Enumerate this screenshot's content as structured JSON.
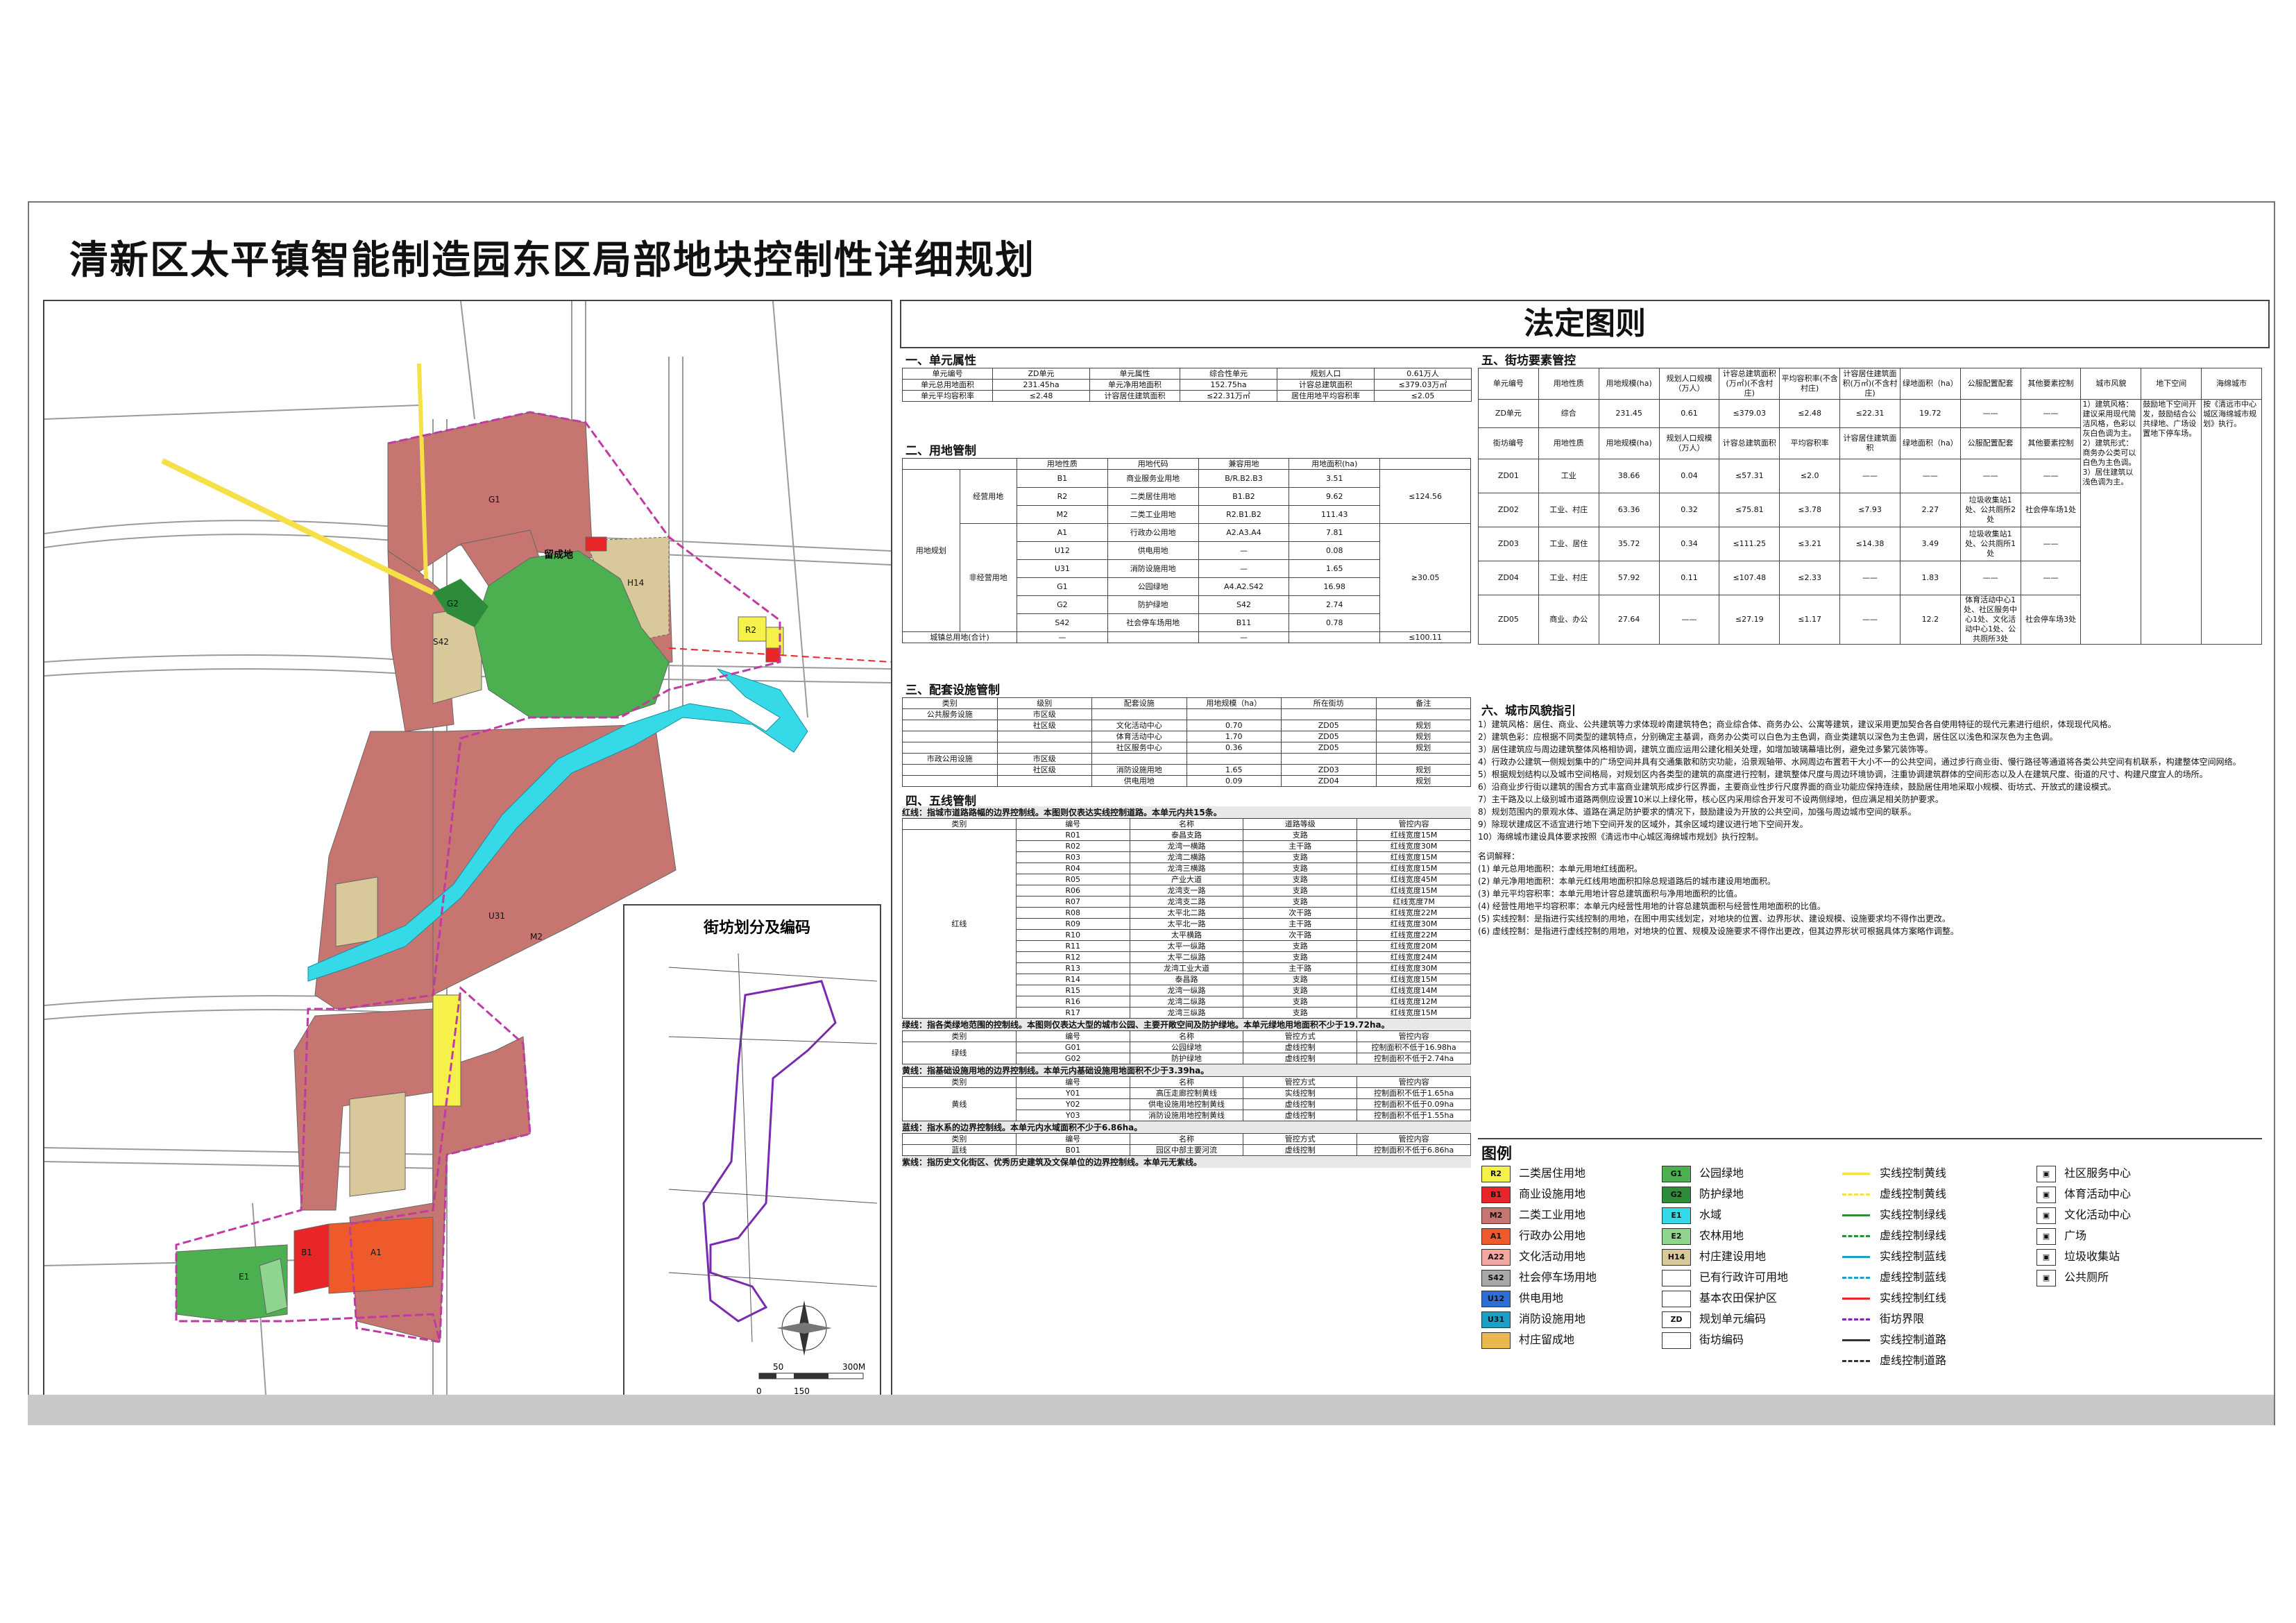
{
  "title": "清新区太平镇智能制造园东区局部地块控制性详细规划",
  "legal_header": "法定图则",
  "map": {
    "inset_title": "街坊划分及编码",
    "scale_labels": [
      "0",
      "50",
      "150",
      "300M"
    ],
    "labels": {
      "zhichengdi": "留成地",
      "g1": "G1",
      "r2": "R2",
      "m2": "M2",
      "h14": "H14",
      "e1": "E1",
      "a1": "A1",
      "a22": "A22",
      "s42": "S42",
      "u31": "U31",
      "b1": "B1",
      "g2": "G2"
    }
  },
  "sec1": {
    "heading": "一、单元属性",
    "rows": [
      [
        "单元编号",
        "ZD单元",
        "单元属性",
        "综合性单元",
        "规划人口",
        "0.61万人"
      ],
      [
        "单元总用地面积",
        "231.45ha",
        "单元净用地面积",
        "152.75ha",
        "计容总建筑面积",
        "≤379.03万㎡"
      ],
      [
        "单元平均容积率",
        "≤2.48",
        "计容居住建筑面积",
        "≤22.31万㎡",
        "居住用地平均容积率",
        "≤2.05"
      ]
    ]
  },
  "sec2": {
    "heading": "二、用地管制",
    "col_headers": [
      "用地性质",
      "用地代码",
      "兼容用地",
      "用地面积(ha)"
    ],
    "group_main": "用地规划",
    "group_a": "经营用地",
    "group_b": "非经营用地",
    "rows": [
      [
        "B1",
        "商业服务业用地",
        "B/R.B2.B3",
        "3.51"
      ],
      [
        "R2",
        "二类居住用地",
        "B1.B2",
        "9.62"
      ],
      [
        "M2",
        "二类工业用地",
        "R2.B1.B2",
        "111.43"
      ],
      [
        "A1",
        "行政办公用地",
        "A2.A3.A4",
        "7.81"
      ],
      [
        "U12",
        "供电用地",
        "—",
        "0.08"
      ],
      [
        "U31",
        "消防设施用地",
        "—",
        "1.65"
      ],
      [
        "G1",
        "公园绿地",
        "A4.A2.S42",
        "16.98"
      ],
      [
        "G2",
        "防护绿地",
        "S42",
        "2.74"
      ],
      [
        "S42",
        "社会停车场用地",
        "B11",
        "0.78"
      ]
    ],
    "sum_a": "≤124.56",
    "sum_b": "≥30.05",
    "total_label": "城镇总用地(合计)",
    "total_dash": "—",
    "total_val": "≤100.11"
  },
  "sec3": {
    "heading": "三、配套设施管制",
    "headers": [
      "类别",
      "级别",
      "配套设施",
      "用地规模（ha）",
      "所在街坊",
      "备注"
    ],
    "rows": [
      [
        "公共服务设施",
        "市区级",
        "",
        "",
        "",
        ""
      ],
      [
        "",
        "社区级",
        "文化活动中心",
        "0.70",
        "ZD05",
        "规划"
      ],
      [
        "",
        "",
        "体育活动中心",
        "1.70",
        "ZD05",
        "规划"
      ],
      [
        "",
        "",
        "社区服务中心",
        "0.36",
        "ZD05",
        "规划"
      ],
      [
        "市政公用设施",
        "市区级",
        "",
        "",
        "",
        ""
      ],
      [
        "",
        "社区级",
        "消防设施用地",
        "1.65",
        "ZD03",
        "规划"
      ],
      [
        "",
        "",
        "供电用地",
        "0.09",
        "ZD04",
        "规划"
      ]
    ]
  },
  "sec4": {
    "heading": "四、五线管制",
    "red_note": "红线：指城市道路路幅的边界控制线。本图则仅表达实线控制道路。本单元内共15条。",
    "red_headers": [
      "类别",
      "编号",
      "名称",
      "道路等级",
      "管控内容"
    ],
    "red_cat": "红线",
    "red_rows": [
      [
        "R01",
        "泰昌支路",
        "支路",
        "红线宽度15M"
      ],
      [
        "R02",
        "龙湾一横路",
        "主干路",
        "红线宽度30M"
      ],
      [
        "R03",
        "龙湾二横路",
        "支路",
        "红线宽度15M"
      ],
      [
        "R04",
        "龙湾三横路",
        "支路",
        "红线宽度15M"
      ],
      [
        "R05",
        "产业大道",
        "支路",
        "红线宽度45M"
      ],
      [
        "R06",
        "龙湾支一路",
        "支路",
        "红线宽度15M"
      ],
      [
        "R07",
        "龙湾支二路",
        "支路",
        "红线宽度7M"
      ],
      [
        "R08",
        "太平北二路",
        "次干路",
        "红线宽度22M"
      ],
      [
        "R09",
        "太平北一路",
        "主干路",
        "红线宽度30M"
      ],
      [
        "R10",
        "太平横路",
        "次干路",
        "红线宽度22M"
      ],
      [
        "R11",
        "太平一纵路",
        "支路",
        "红线宽度20M"
      ],
      [
        "R12",
        "太平二纵路",
        "支路",
        "红线宽度24M"
      ],
      [
        "R13",
        "龙湾工业大道",
        "主干路",
        "红线宽度30M"
      ],
      [
        "R14",
        "泰昌路",
        "支路",
        "红线宽度15M"
      ],
      [
        "R15",
        "龙湾一纵路",
        "支路",
        "红线宽度14M"
      ],
      [
        "R16",
        "龙湾二纵路",
        "支路",
        "红线宽度12M"
      ],
      [
        "R17",
        "龙湾三纵路",
        "支路",
        "红线宽度15M"
      ]
    ],
    "green_note": "绿线：指各类绿地范围的控制线。本图则仅表达大型的城市公园、主要开敞空间及防护绿地。本单元绿地用地面积不少于19.72ha。",
    "green_headers": [
      "类别",
      "编号",
      "名称",
      "管控方式",
      "管控内容"
    ],
    "green_cat": "绿线",
    "green_rows": [
      [
        "G01",
        "公园绿地",
        "虚线控制",
        "控制面积不低于16.98ha"
      ],
      [
        "G02",
        "防护绿地",
        "虚线控制",
        "控制面积不低于2.74ha"
      ]
    ],
    "yellow_note": "黄线：指基础设施用地的边界控制线。本单元内基础设施用地面积不少于3.39ha。",
    "yellow_headers": [
      "类别",
      "编号",
      "名称",
      "管控方式",
      "管控内容"
    ],
    "yellow_cat": "黄线",
    "yellow_rows": [
      [
        "Y01",
        "高压走廊控制黄线",
        "实线控制",
        "控制面积不低于1.65ha"
      ],
      [
        "Y02",
        "供电设施用地控制黄线",
        "虚线控制",
        "控制面积不低于0.09ha"
      ],
      [
        "Y03",
        "消防设施用地控制黄线",
        "虚线控制",
        "控制面积不低于1.55ha"
      ]
    ],
    "blue_note": "蓝线：指水系的边界控制线。本单元内水域面积不少于6.86ha。",
    "blue_headers": [
      "类别",
      "编号",
      "名称",
      "管控方式",
      "管控内容"
    ],
    "blue_cat": "蓝线",
    "blue_rows": [
      [
        "B01",
        "园区中部主要河流",
        "虚线控制",
        "控制面积不低于6.86ha"
      ]
    ],
    "purple_note": "紫线：指历史文化街区、优秀历史建筑及文保单位的边界控制线。本单元无紫线。"
  },
  "sec5": {
    "heading": "五、街坊要素管控",
    "headers": [
      "单元编号",
      "用地性质",
      "用地规模(ha)",
      "规划人口规模（万人）",
      "计容总建筑面积(万㎡)(不含村庄)",
      "平均容积率(不含村庄)",
      "计容居住建筑面积(万㎡)(不含村庄)",
      "绿地面积（ha）",
      "公服配置配套",
      "其他要素控制",
      "城市风貌",
      "地下空间",
      "海绵城市"
    ],
    "unit_row": [
      "ZD单元",
      "综合",
      "231.45",
      "0.61",
      "≤379.03",
      "≤2.48",
      "≤22.31",
      "19.72",
      "——",
      "——"
    ],
    "sub_headers": [
      "街坊编号",
      "用地性质",
      "用地规模(ha)",
      "规划人口规模（万人）",
      "计容总建筑面积",
      "平均容积率",
      "计容居住建筑面积",
      "绿地面积（ha）",
      "公服配置配套",
      "其他要素控制"
    ],
    "rows": [
      [
        "ZD01",
        "工业",
        "38.66",
        "0.04",
        "≤57.31",
        "≤2.0",
        "——",
        "——",
        "——",
        "——"
      ],
      [
        "ZD02",
        "工业、村庄",
        "63.36",
        "0.32",
        "≤75.81",
        "≤3.78",
        "≤7.93",
        "2.27",
        "垃圾收集站1处、公共厕所2处",
        "社会停车场1处"
      ],
      [
        "ZD03",
        "工业、居住",
        "35.72",
        "0.34",
        "≤111.25",
        "≤3.21",
        "≤14.38",
        "3.49",
        "垃圾收集站1处、公共厕所1处",
        "——"
      ],
      [
        "ZD04",
        "工业、村庄",
        "57.92",
        "0.11",
        "≤107.48",
        "≤2.33",
        "——",
        "1.83",
        "——",
        "——"
      ],
      [
        "ZD05",
        "商业、办公",
        "27.64",
        "——",
        "≤27.19",
        "≤1.17",
        "——",
        "12.2",
        "体育活动中心1处、社区服务中心1处、文化活动中心1处、公共厕所3处",
        "社会停车场3处"
      ]
    ],
    "fengmao_text": "1）建筑风格：建议采用现代简洁风格，色彩以灰白色调为主。2）建筑形式：商务办公类可以白色为主色调。3）居住建筑以浅色调为主。",
    "dixia_text": "鼓励地下空间开发，鼓励结合公共绿地、广场设置地下停车场。",
    "haimian_text": "按《清远市中心城区海绵城市规划》执行。"
  },
  "sec6": {
    "heading": "六、城市风貌指引",
    "items": [
      "1）建筑风格：居住、商业、公共建筑等力求体现岭南建筑特色；商业综合体、商务办公、公寓等建筑，建议采用更加契合各自使用特征的现代元素进行组织，体现现代风格。",
      "2）建筑色彩：应根据不同类型的建筑特点，分别确定主基调，商务办公类可以白色为主色调，商业类建筑以深色为主色调，居住区以浅色和深灰色为主色调。",
      "3）居住建筑应与周边建筑整体风格相协调，建筑立面应运用公建化相关处理，如增加玻璃幕墙比例，避免过多繁冗装饰等。",
      "4）行政办公建筑一侧规划集中的广场空间并具有交通集散和防灾功能，沿景观轴带、水网周边布置若干大小不一的公共空间，通过步行商业街、慢行路径等通道将各类公共空间有机联系，构建整体空间网络。",
      "5）根据规划结构以及城市空间格局，对规划区内各类型的建筑的高度进行控制，建筑整体尺度与周边环境协调，注重协调建筑群体的空间形态以及人在建筑尺度、街道的尺寸、构建尺度宜人的场所。",
      "6）沿商业步行街以建筑的围合方式丰富商业建筑形成步行区界面，主要商业性步行尺度界面的商业功能应保持连续，鼓励居住用地采取小规模、街坊式、开放式的建设模式。",
      "7）主干路及以上级别城市道路两侧应设置10米以上绿化带，核心区内采用综合开发可不设两侧绿地，但应满足相关防护要求。",
      "8）规划范围内的景观水体、道路在满足防护要求的情况下，鼓励建设为开放的公共空间，加强与周边城市空间的联系。",
      "9）除现状建成区不适宜进行地下空间开发的区域外，其余区域均建议进行地下空间开发。",
      "10）海绵城市建设具体要求按照《清远市中心城区海绵城市规划》执行控制。"
    ],
    "terms_heading": "名词解释：",
    "terms": [
      "(1) 单元总用地面积：本单元用地红线面积。",
      "(2) 单元净用地面积：本单元红线用地面积扣除总规道路后的城市建设用地面积。",
      "(3) 单元平均容积率：本单元用地计容总建筑面积与净用地面积的比值。",
      "(4) 经营性用地平均容积率：本单元内经营性用地的计容总建筑面积与经营性用地面积的比值。",
      "(5) 实线控制：是指进行实线控制的用地，在图中用实线划定，对地块的位置、边界形状、建设规模、设施要求均不得作出更改。",
      "(6) 虚线控制：是指进行虚线控制的用地，对地块的位置、规模及设施要求不得作出更改，但其边界形状可根据具体方案略作调整。"
    ]
  },
  "legend": {
    "heading": "图例",
    "items": [
      {
        "code": "R2",
        "label": "二类居住用地",
        "color": "#f5f04a"
      },
      {
        "code": "B1",
        "label": "商业设施用地",
        "color": "#e8262a"
      },
      {
        "code": "M2",
        "label": "二类工业用地",
        "color": "#c77570"
      },
      {
        "code": "A1",
        "label": "行政办公用地",
        "color": "#ee5a2c"
      },
      {
        "code": "A22",
        "label": "文化活动用地",
        "color": "#f4a6a0"
      },
      {
        "code": "S42",
        "label": "社会停车场用地",
        "color": "#a8a8a8"
      },
      {
        "code": "U12",
        "label": "供电用地",
        "color": "#2e6fd6"
      },
      {
        "code": "U31",
        "label": "消防设施用地",
        "color": "#1ca0c8"
      },
      {
        "code": "",
        "label": "村庄留成地",
        "color": "#e8b84e"
      },
      {
        "code": "G1",
        "label": "公园绿地",
        "color": "#4caf50"
      },
      {
        "code": "G2",
        "label": "防护绿地",
        "color": "#2e8b3a"
      },
      {
        "code": "E1",
        "label": "水域",
        "color": "#36d9e8"
      },
      {
        "code": "E2",
        "label": "农林用地",
        "color": "#8fd48f"
      },
      {
        "code": "H14",
        "label": "村庄建设用地",
        "color": "#d9c99a"
      },
      {
        "code": "",
        "label": "已有行政许可用地",
        "color": "#ffffff"
      },
      {
        "code": "",
        "label": "基本农田保护区",
        "color": "#ffffff"
      },
      {
        "code": "ZD",
        "label": "规划单元编码",
        "color": "#ffffff"
      },
      {
        "code": "",
        "label": "街坊编码",
        "color": "#ffffff"
      }
    ],
    "lines": [
      "实线控制黄线",
      "虚线控制黄线",
      "实线控制绿线",
      "虚线控制绿线",
      "实线控制蓝线",
      "虚线控制蓝线",
      "实线控制红线",
      "街坊界限",
      "实线控制道路",
      "虚线控制道路"
    ],
    "facilities": [
      "社区服务中心",
      "体育活动中心",
      "文化活动中心",
      "广场",
      "垃圾收集站",
      "公共厕所"
    ]
  }
}
